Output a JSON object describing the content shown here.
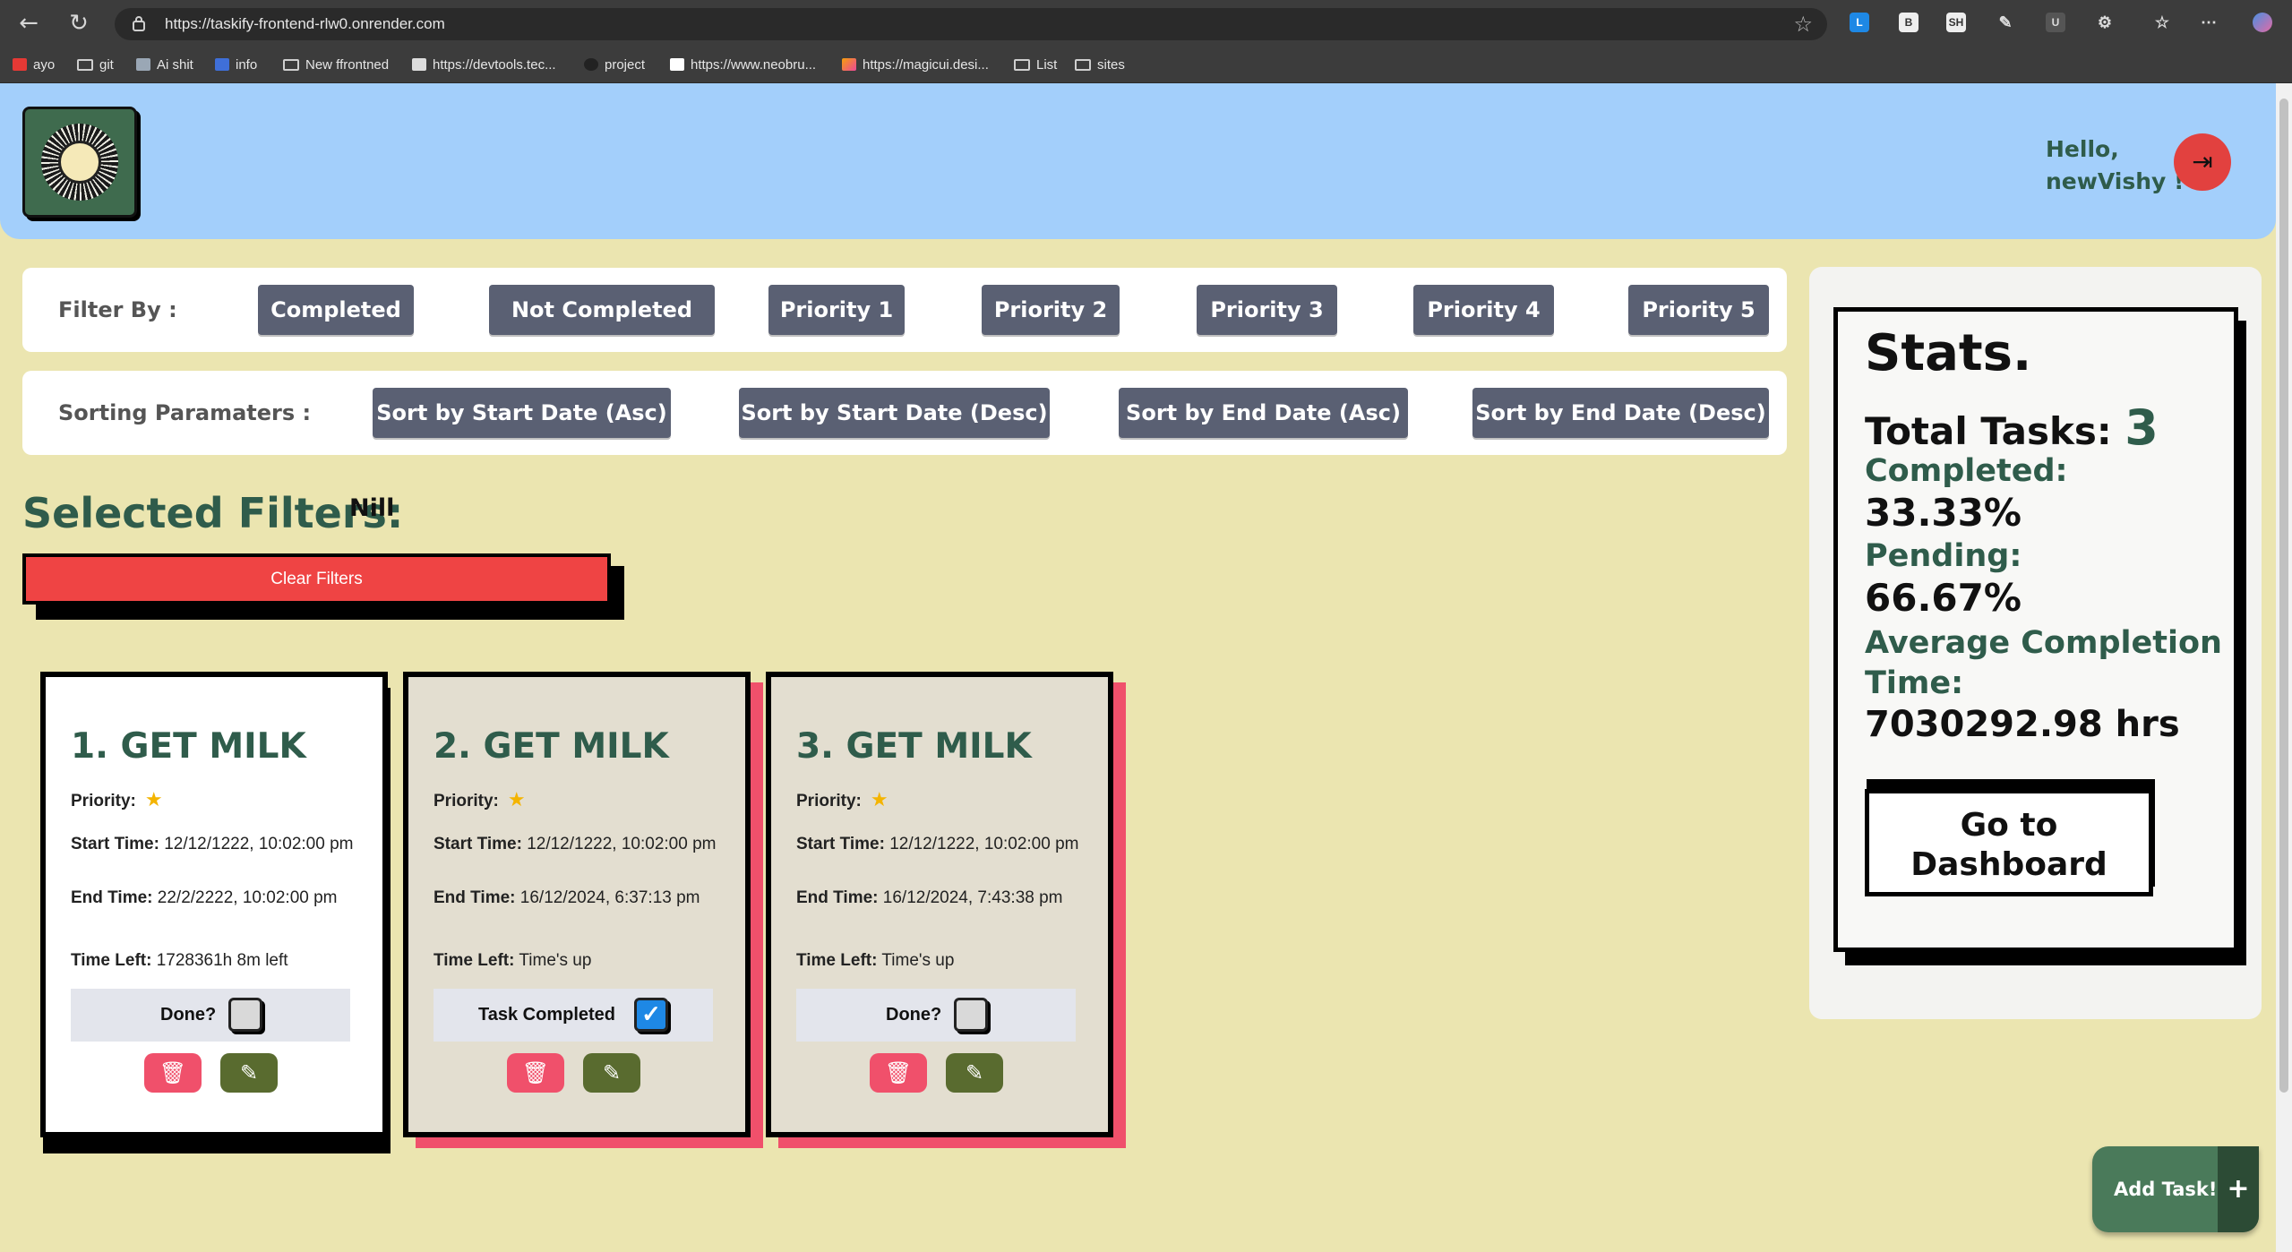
{
  "browser": {
    "url": "https://taskify-frontend-rlw0.onrender.com",
    "bookmarks": [
      {
        "label": "ayo",
        "icon": "tuf-icon"
      },
      {
        "label": "git",
        "icon": "folder-icon"
      },
      {
        "label": "Ai shit",
        "icon": "ai-icon"
      },
      {
        "label": "info",
        "icon": "tf-icon"
      },
      {
        "label": "New ffrontned",
        "icon": "folder-icon"
      },
      {
        "label": "https://devtools.tec...",
        "icon": "page-icon"
      },
      {
        "label": "project",
        "icon": "cm-icon"
      },
      {
        "label": "https://www.neobru...",
        "icon": "notion-icon"
      },
      {
        "label": "https://magicui.desi...",
        "icon": "magicui-icon"
      },
      {
        "label": "List",
        "icon": "folder-icon"
      },
      {
        "label": "sites",
        "icon": "folder-icon"
      }
    ]
  },
  "header": {
    "greeting_line1": "Hello,",
    "greeting_line2": "newVishy !"
  },
  "filters": {
    "label": "Filter By :",
    "options": [
      "Completed",
      "Not Completed",
      "Priority 1",
      "Priority 2",
      "Priority 3",
      "Priority 4",
      "Priority 5"
    ]
  },
  "sorting": {
    "label": "Sorting Paramaters :",
    "options": [
      "Sort by Start Date (Asc)",
      "Sort by Start Date (Desc)",
      "Sort by End Date (Asc)",
      "Sort by End Date (Desc)"
    ]
  },
  "selected_filters": {
    "title": "Selected Filters:",
    "value": "Nill",
    "clear_label": "Clear Filters"
  },
  "labels": {
    "priority": "Priority:",
    "start": "Start Time:",
    "end": "End Time:",
    "time_left": "Time Left:"
  },
  "tasks": [
    {
      "title": "1. GET MILK",
      "priority_stars": "★",
      "start_time": "12/12/1222, 10:02:00 pm",
      "end_time": "22/2/2222, 10:02:00 pm",
      "time_left": "1728361h 8m left",
      "status_label": "Done?",
      "completed": false
    },
    {
      "title": "2. GET MILK",
      "priority_stars": "★",
      "start_time": "12/12/1222, 10:02:00 pm",
      "end_time": "16/12/2024, 6:37:13 pm",
      "time_left": "Time's up",
      "status_label": "Task Completed",
      "completed": true
    },
    {
      "title": "3. GET MILK",
      "priority_stars": "★",
      "start_time": "12/12/1222, 10:02:00 pm",
      "end_time": "16/12/2024, 7:43:38 pm",
      "time_left": "Time's up",
      "status_label": "Done?",
      "completed": false
    }
  ],
  "stats": {
    "title": "Stats.",
    "total_label": "Total Tasks:",
    "total_value": "3",
    "completed_label": "Completed:",
    "completed_value": "33.33%",
    "pending_label": "Pending:",
    "pending_value": "66.67%",
    "avg_label_line1": "Average Completion",
    "avg_label_line2": "Time:",
    "avg_value": "7030292.98 hrs",
    "dashboard_line1": "Go to",
    "dashboard_line2": "Dashboard"
  },
  "add_task": {
    "label": "Add Task!",
    "plus": "+"
  },
  "colors": {
    "page_bg": "#ebe5b0",
    "header_bg": "#a3cffb",
    "accent_green": "#2f5c4b",
    "chip_bg": "#5a6073",
    "danger": "#ef4444",
    "completed_card_bg": "#e3ded0",
    "completed_card_shadow": "#f0506b"
  }
}
